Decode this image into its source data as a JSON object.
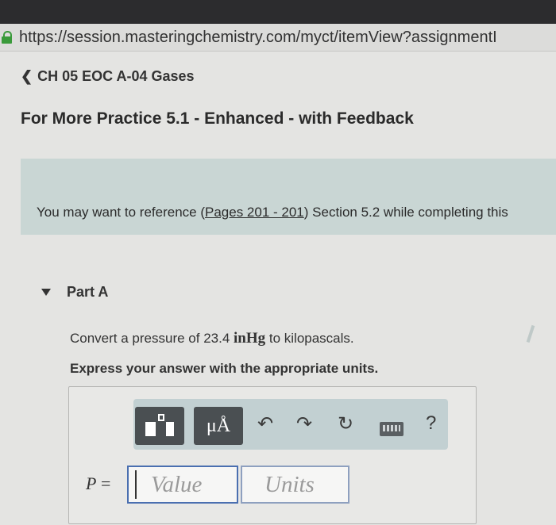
{
  "browser": {
    "url": "https://session.masteringchemistry.com/myct/itemView?assignmentI"
  },
  "header": {
    "back_label": "CH 05 EOC A-04 Gases",
    "title": "For More Practice 5.1 - Enhanced - with Feedback"
  },
  "reference": {
    "prefix": "You may want to reference (",
    "pages_link": "Pages 201 - 201",
    "suffix": ") Section 5.2 while completing this"
  },
  "part": {
    "label": "Part A",
    "question_prefix": "Convert a pressure of 23.4 ",
    "question_unit": "inHg",
    "question_suffix": " to kilopascals.",
    "instruction": "Express your answer with the appropriate units."
  },
  "toolbar": {
    "units_button_label": "μÅ",
    "undo_glyph": "↶",
    "redo_glyph": "↷",
    "reset_glyph": "↻",
    "help_glyph": "?"
  },
  "answer": {
    "variable": "P",
    "equals": " =",
    "value_placeholder": "Value",
    "units_placeholder": "Units"
  }
}
